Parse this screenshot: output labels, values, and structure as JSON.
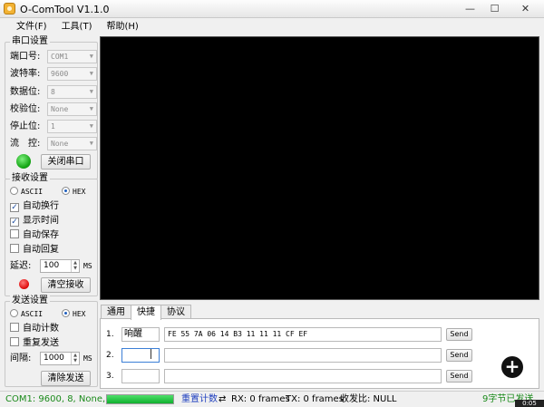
{
  "window": {
    "title": "O-ComTool V1.1.0",
    "minimize": "—",
    "maximize": "☐",
    "close": "✕"
  },
  "menu": [
    "文件(F)",
    "工具(T)",
    "帮助(H)"
  ],
  "serial": {
    "group_title": "串口设置",
    "port_label": "端口号:",
    "port_value": "COM1",
    "baud_label": "波特率:",
    "baud_value": "9600",
    "data_label": "数据位:",
    "data_value": "8",
    "parity_label": "校验位:",
    "parity_value": "None",
    "stop_label": "停止位:",
    "stop_value": "1",
    "flow_label": "流　控:",
    "flow_value": "None",
    "close_button": "关闭串口"
  },
  "receive": {
    "group_title": "接收设置",
    "ascii": "ASCII",
    "hex": "HEX",
    "auto_newline": "自动换行",
    "show_time": "显示时间",
    "auto_save": "自动保存",
    "auto_reply": "自动回复",
    "delay_label": "延迟:",
    "delay_value": "100",
    "delay_unit": "MS",
    "clear_button": "清空接收"
  },
  "send": {
    "group_title": "发送设置",
    "ascii": "ASCII",
    "hex": "HEX",
    "auto_count": "自动计数",
    "repeat_send": "重复发送",
    "interval_label": "间隔:",
    "interval_value": "1000",
    "interval_unit": "MS",
    "clear_button": "清除发送"
  },
  "tabs": [
    "通用",
    "快捷",
    "协议"
  ],
  "quick": [
    {
      "num": "1.",
      "name": "响醒",
      "data": "FE 55 7A 06 14 B3 11 11 11 CF EF",
      "send": "Send"
    },
    {
      "num": "2.",
      "name": "",
      "data": "",
      "send": "Send"
    },
    {
      "num": "3.",
      "name": "",
      "data": "",
      "send": "Send"
    }
  ],
  "status": {
    "port_info": "COM1: 9600, 8, None, 1",
    "progress": 1.0,
    "reset_count": "重置计数",
    "rx": "RX: 0 frames",
    "tx": "TX: 0 frames",
    "ratio": "收发比: NULL",
    "bytes_sent": "9字节已发送"
  },
  "overlay_time": "0:05",
  "add_icon": "+"
}
